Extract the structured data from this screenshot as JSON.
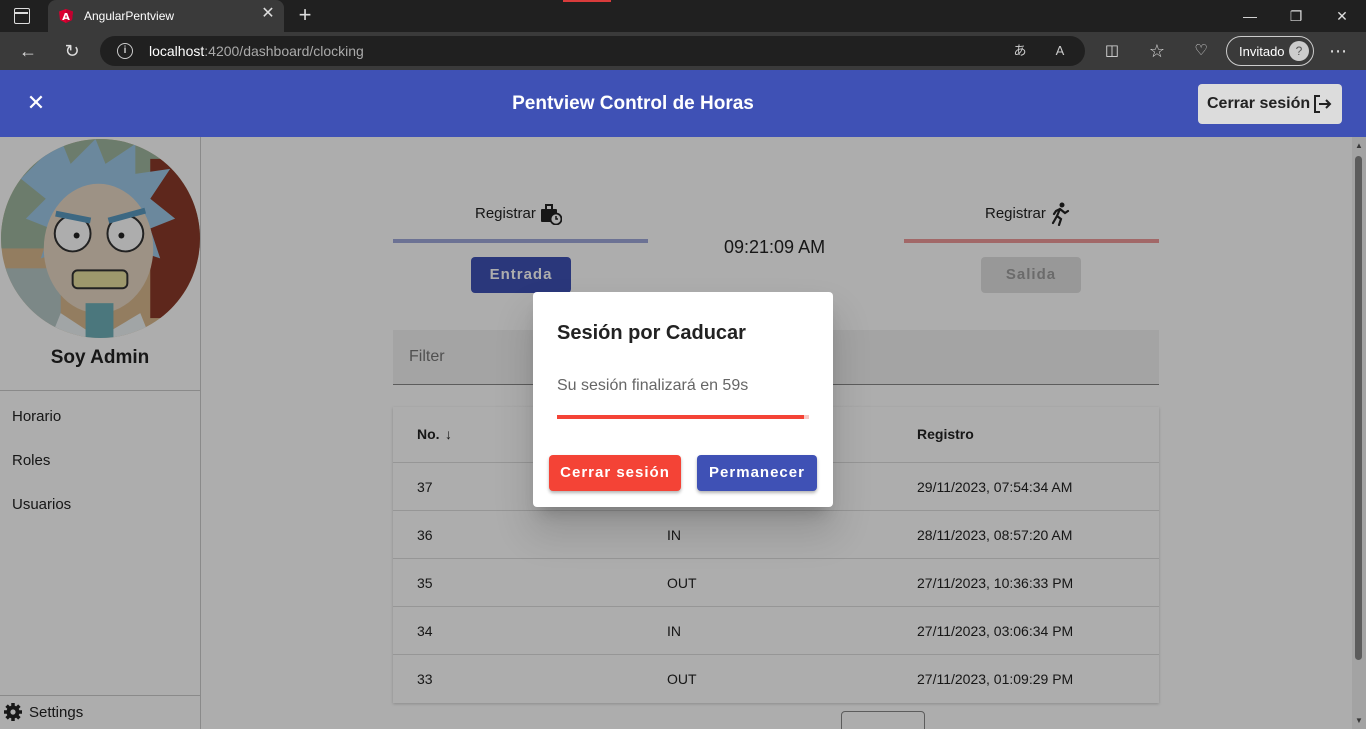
{
  "browser": {
    "tab_title": "AngularPentview",
    "url_host": "localhost",
    "url_path": ":4200/dashboard/clocking",
    "profile_label": "Invitado"
  },
  "header": {
    "title": "Pentview Control de Horas",
    "logout_label": "Cerrar sesión"
  },
  "sidebar": {
    "user_name": "Soy Admin",
    "items": [
      {
        "label": "Horario"
      },
      {
        "label": "Roles"
      },
      {
        "label": "Usuarios"
      }
    ],
    "settings_label": "Settings"
  },
  "clocking": {
    "entry_register_label": "Registrar",
    "exit_register_label": "Registrar",
    "time": "09:21:09 AM",
    "entry_button": "Entrada",
    "exit_button": "Salida",
    "filter_placeholder": "Filter"
  },
  "table": {
    "headers": {
      "no": "No.",
      "type": "",
      "registro": "Registro"
    },
    "rows": [
      {
        "no": "37",
        "type": "",
        "registro": "29/11/2023, 07:54:34 AM"
      },
      {
        "no": "36",
        "type": "IN",
        "registro": "28/11/2023, 08:57:20 AM"
      },
      {
        "no": "35",
        "type": "OUT",
        "registro": "27/11/2023, 10:36:33 PM"
      },
      {
        "no": "34",
        "type": "IN",
        "registro": "27/11/2023, 03:06:34 PM"
      },
      {
        "no": "33",
        "type": "OUT",
        "registro": "27/11/2023, 01:09:29 PM"
      }
    ]
  },
  "dialog": {
    "title": "Sesión por Caducar",
    "message": "Su sesión finalizará en 59s",
    "progress": 0.98,
    "logout_button": "Cerrar sesión",
    "stay_button": "Permanecer"
  },
  "colors": {
    "primary": "#3f51b5",
    "warn": "#f44336",
    "entry_line": "#9fa8da",
    "exit_line": "#ef9a9a"
  }
}
